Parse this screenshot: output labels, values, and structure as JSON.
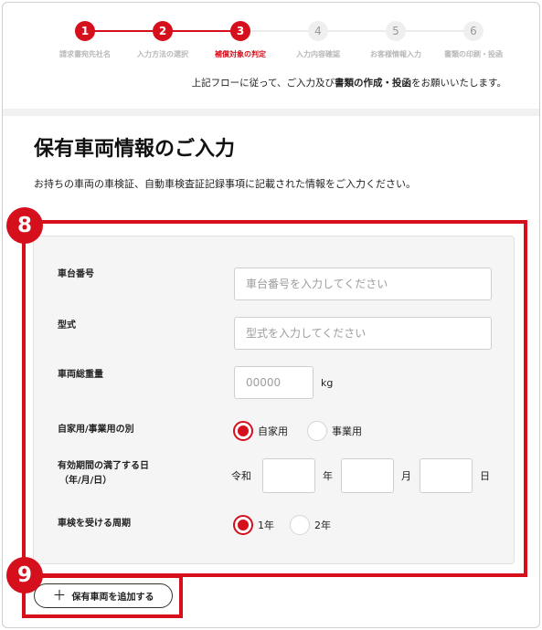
{
  "stepper": {
    "steps": [
      {
        "num": "1",
        "label": "請求書宛先社名"
      },
      {
        "num": "2",
        "label": "入力方法の選択"
      },
      {
        "num": "3",
        "label": "補償対象の判定"
      },
      {
        "num": "4",
        "label": "入力内容確認"
      },
      {
        "num": "5",
        "label": "お客様情報入力"
      },
      {
        "num": "6",
        "label": "書類の印刷・投函"
      }
    ],
    "current_step": 3,
    "accent_color": "#d50f1c"
  },
  "flow_note": {
    "prefix": "上記フローに従って、ご入力及び",
    "emphasis": "書類の作成・投函",
    "suffix": "をお願いいたします。"
  },
  "section": {
    "title": "保有車両情報のご入力",
    "description": "お持ちの車両の車検証、自動車検査証記録事項に記載された情報をご入力ください。"
  },
  "annotations": {
    "form_badge": "8",
    "add_badge": "9"
  },
  "form": {
    "chassis_number": {
      "label": "車台番号",
      "placeholder": "車台番号を入力してください",
      "value": ""
    },
    "model": {
      "label": "型式",
      "placeholder": "型式を入力してください",
      "value": ""
    },
    "gross_weight": {
      "label": "車両総重量",
      "placeholder": "00000",
      "unit": "kg"
    },
    "usage": {
      "label": "自家用/事業用の別",
      "options": [
        "自家用",
        "事業用"
      ],
      "selected": "自家用"
    },
    "expiry": {
      "label_line1": "有効期間の満了する日",
      "label_line2": "（年/月/日）",
      "era": "令和",
      "year_unit": "年",
      "month_unit": "月",
      "day_unit": "日"
    },
    "inspection_cycle": {
      "label": "車検を受ける周期",
      "options": [
        "1年",
        "2年"
      ],
      "selected": "1年"
    }
  },
  "add_vehicle_button": {
    "icon": "plus-icon",
    "label": "保有車両を追加する"
  }
}
